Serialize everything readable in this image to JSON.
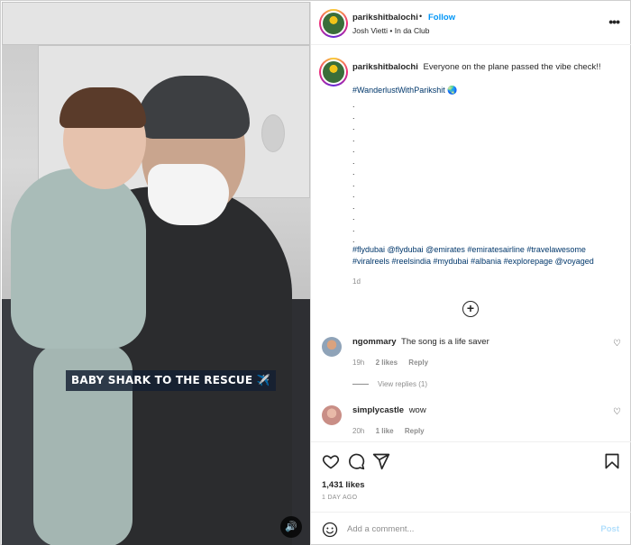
{
  "post": {
    "username": "parikshitbalochi",
    "dot": "•",
    "follow_label": "Follow",
    "location": "Josh Vietti • In da Club",
    "more_icon": "more-options-icon"
  },
  "media": {
    "overlay_caption": "BABY SHARK TO THE RESCUE ✈️",
    "mute_icon": "speaker-icon"
  },
  "caption": {
    "username": "parikshitbalochi",
    "text": "Everyone on the plane passed the vibe check!!",
    "hashtag": "#WanderlustWithParikshit 🌏",
    "dots": ".\n.\n.\n.\n.\n.\n.\n.\n.\n.\n.\n.\n.",
    "tags": "#flydubai @flydubai @emirates #emiratesairline #travelawesome #viralreels #reelsindia #mydubai #albania #explorepage @voyaged",
    "time": "1d"
  },
  "comments": [
    {
      "username": "ngommary",
      "text": "The song is a life saver",
      "time": "19h",
      "likes": "2 likes",
      "reply": "Reply",
      "view_replies": "View replies (1)"
    },
    {
      "username": "simplycastle",
      "text": "wow",
      "time": "20h",
      "likes": "1 like",
      "reply": "Reply"
    }
  ],
  "actions": {
    "likes": "1,431 likes",
    "date": "1 DAY AGO",
    "icons": [
      "heart-icon",
      "comment-icon",
      "share-icon",
      "bookmark-icon"
    ]
  },
  "add_comment": {
    "placeholder": "Add a comment...",
    "post_label": "Post"
  },
  "colors": {
    "link_blue": "#0095f6",
    "hashtag": "#00376b",
    "muted": "#8e8e8e",
    "post_disabled": "#b2dffc"
  }
}
